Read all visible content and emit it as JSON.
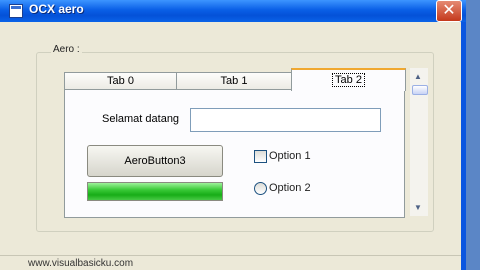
{
  "window": {
    "title": "OCX aero",
    "close_label": "✕"
  },
  "group": {
    "label": "Aero :"
  },
  "tabs": [
    {
      "label": "Tab 0"
    },
    {
      "label": "Tab 1"
    },
    {
      "label": "Tab 2",
      "selected": true
    }
  ],
  "panel": {
    "welcome_label": "Selamat datang",
    "text_value": "",
    "button_label": "AeroButton3",
    "progress_percent": 100,
    "checkbox": {
      "label": "Option 1",
      "checked": false
    },
    "radio": {
      "label": "Option 2",
      "selected": false
    }
  },
  "scrollbar": {
    "up_arrow": "▲",
    "down_arrow": "▼"
  },
  "status": {
    "text": "www.visualbasicku.com"
  },
  "icons": [
    "app-window-icon",
    "close-icon",
    "scroll-up-icon",
    "scroll-down-icon"
  ],
  "colors": {
    "titlebar": "#0a5fe6",
    "progress": "#17ad17",
    "window_bg": "#ece9d8",
    "close": "#c4391c"
  }
}
